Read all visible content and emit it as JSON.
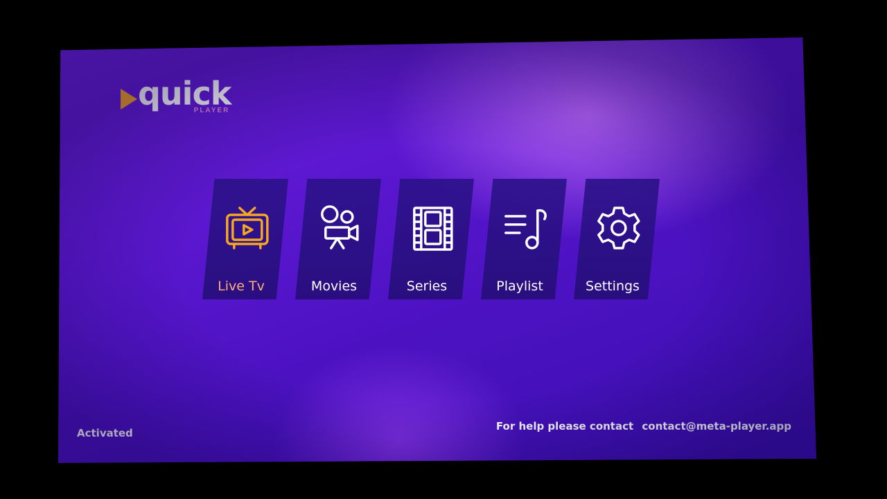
{
  "brand": {
    "name": "quick",
    "sub": "PLAYER",
    "accent": "#f5a623",
    "sub_color": "#e08ad8"
  },
  "menu": [
    {
      "label": "Live Tv",
      "icon": "tv-icon",
      "active": true
    },
    {
      "label": "Movies",
      "icon": "movie-camera-icon",
      "active": false
    },
    {
      "label": "Series",
      "icon": "film-strip-icon",
      "active": false
    },
    {
      "label": "Playlist",
      "icon": "playlist-music-icon",
      "active": false
    },
    {
      "label": "Settings",
      "icon": "gear-icon",
      "active": false
    }
  ],
  "footer": {
    "status": "Activated",
    "help_prefix": "For help please contact",
    "help_email": "contact@meta-player.app"
  },
  "colors": {
    "active_icon": "#f5a623",
    "active_label": "#ffb07a",
    "tile_bg": "#2d128c"
  }
}
